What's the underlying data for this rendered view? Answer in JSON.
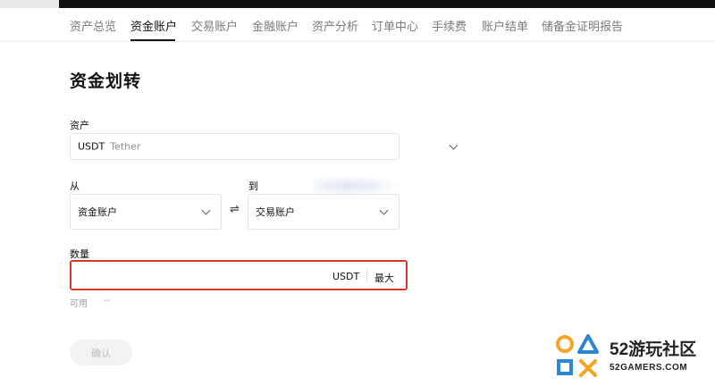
{
  "nav": {
    "tabs": [
      {
        "label": "资产总览"
      },
      {
        "label": "资金账户"
      },
      {
        "label": "交易账户"
      },
      {
        "label": "金融账户"
      },
      {
        "label": "资产分析"
      },
      {
        "label": "订单中心"
      },
      {
        "label": "手续费"
      },
      {
        "label": "账户结单"
      },
      {
        "label": "储备金证明报告"
      }
    ],
    "active_index": 1
  },
  "page": {
    "title": "资金划转"
  },
  "asset": {
    "label": "资产",
    "symbol": "USDT",
    "name": "Tether"
  },
  "transfer": {
    "from_label": "从",
    "from_value": "资金账户",
    "to_label": "到",
    "to_value": "交易账户",
    "swap_glyph": "⇌"
  },
  "amount": {
    "label": "数量",
    "value": "",
    "unit": "USDT",
    "max_label": "最大"
  },
  "available": {
    "label": "可用",
    "value": "--"
  },
  "confirm": {
    "label": "确认"
  },
  "watermark": {
    "title": "52游玩社区",
    "subtitle": "52GAMERS.COM"
  },
  "colors": {
    "accent_border": "#d9372e",
    "text_primary": "#121212",
    "text_muted": "#7a7a7a",
    "watermark_orange": "#f5a524",
    "watermark_blue": "#2f86d6"
  }
}
